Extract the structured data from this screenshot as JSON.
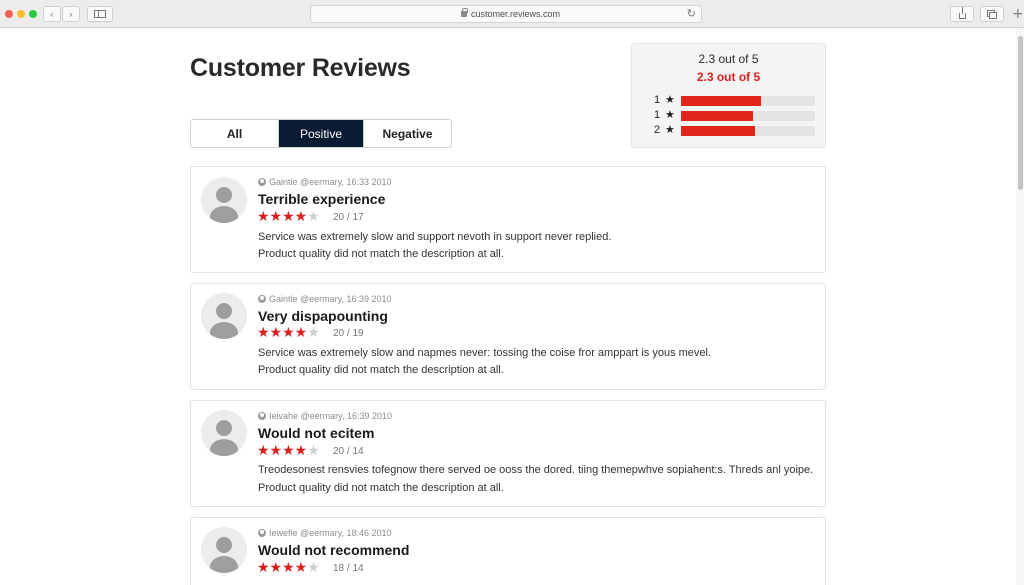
{
  "browser": {
    "url": "customer.reviews.com",
    "icons": {
      "lock": "lock-icon",
      "reload": "reload-icon",
      "back": "chevron-left-icon",
      "forward": "chevron-right-icon",
      "sidebar": "sidebar-icon",
      "share": "share-icon",
      "tabs": "tabs-icon",
      "new_tab": "plus-icon"
    },
    "glyphs": {
      "back": "‹",
      "forward": "›",
      "reload": "↻",
      "new_tab": "+"
    }
  },
  "page": {
    "title": "Customer Reviews"
  },
  "filters": {
    "all": "All",
    "positive": "Positive",
    "negative": "Negative",
    "selected": "Positive"
  },
  "summary": {
    "line1": "2.3 out of 5",
    "line2": "2.3 out of 5",
    "star_glyph": "★",
    "distribution": [
      {
        "label": "1",
        "fraction": 0.6
      },
      {
        "label": "1",
        "fraction": 0.54
      },
      {
        "label": "2",
        "fraction": 0.55
      }
    ]
  },
  "reviews": [
    {
      "meta": "Gaintie @eermary, 16:33 2010",
      "title": "Terrible experience",
      "stars_on": "★★★★",
      "stars_off": "★",
      "rating": 4,
      "count": "20 / 17",
      "lines": [
        "Service was extremely slow and support nevoth in support never replied.",
        "Product quality did not match the description at all."
      ]
    },
    {
      "meta": "Gaintie @eermary, 16:39 2010",
      "title": "Very dispapounting",
      "stars_on": "★★★★",
      "stars_off": "★",
      "rating": 4,
      "count": "20 / 19",
      "lines": [
        "Service was extremely slow and napmes never: tossing the coise fror amppart is yous mevel.",
        "Product quality did not match the description at all."
      ]
    },
    {
      "meta": "Ieivahe @eermary, 16:39 2010",
      "title": "Would not ecitem",
      "stars_on": "★★★★",
      "stars_off": "★",
      "rating": 4,
      "count": "20 / 14",
      "lines": [
        "Treodesonest rensvies tofegnow there served oe ooss the dored. tiing themepwhve sopiahent:s. Threds anl yoipe.",
        "Product quality did not match the description at all."
      ]
    },
    {
      "meta": "Iewefie @eermary, 18:46 2010",
      "title": "Would not recommend",
      "stars_on": "★★★★",
      "stars_off": "★",
      "rating": 4,
      "count": "18 / 14",
      "lines": [
        "",
        ""
      ]
    }
  ],
  "colors": {
    "accent": "#0b1a33",
    "star": "#d81e1e",
    "bar": "#e0261b",
    "avatar": "#9e9e9e"
  }
}
